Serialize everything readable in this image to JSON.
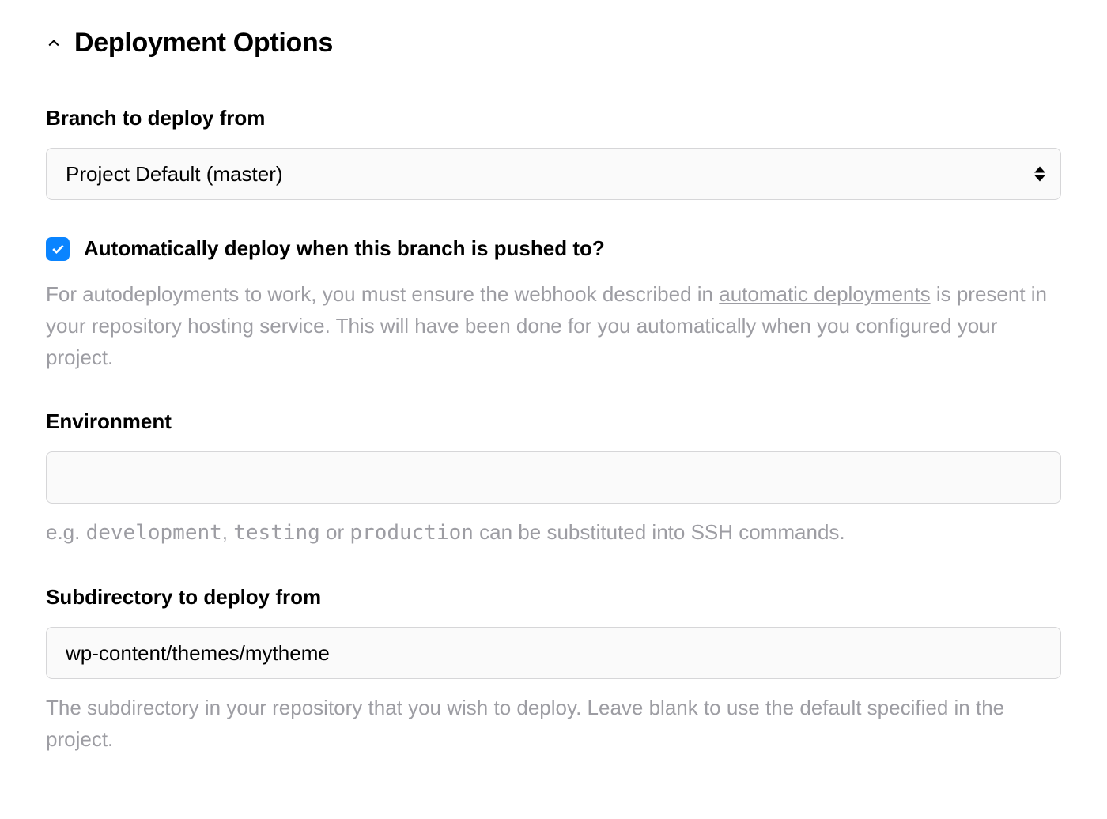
{
  "section": {
    "title": "Deployment Options"
  },
  "branch": {
    "label": "Branch to deploy from",
    "selected": "Project Default (master)"
  },
  "autodeploy": {
    "checkbox_label": "Automatically deploy when this branch is pushed to?",
    "checked": true,
    "help_before": "For autodeployments to work, you must ensure the webhook described in ",
    "help_link": "automatic deployments",
    "help_after": " is present in your repository hosting service. This will have been done for you automatically when you configured your project."
  },
  "environment": {
    "label": "Environment",
    "value": "",
    "help_before": "e.g. ",
    "help_c1": "development",
    "help_sep1": ", ",
    "help_c2": "testing",
    "help_sep2": " or ",
    "help_c3": "production",
    "help_after": " can be substituted into SSH commands."
  },
  "subdirectory": {
    "label": "Subdirectory to deploy from",
    "value": "wp-content/themes/mytheme",
    "help": "The subdirectory in your repository that you wish to deploy. Leave blank to use the default specified in the project."
  }
}
